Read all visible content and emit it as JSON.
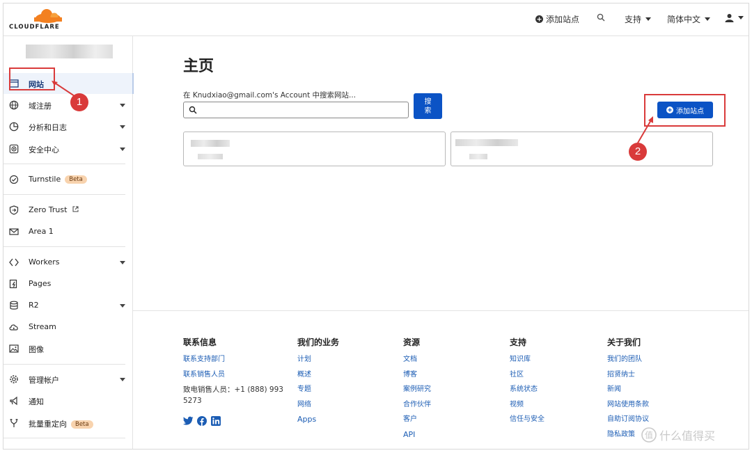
{
  "topbar": {
    "logo_text": "CLOUDFLARE",
    "add_site": "添加站点",
    "support": "支持",
    "language": "简体中文"
  },
  "sidebar": {
    "items": [
      {
        "label": "网站"
      },
      {
        "label": "域注册"
      },
      {
        "label": "分析和日志"
      },
      {
        "label": "安全中心"
      },
      {
        "label": "Turnstile",
        "badge": "Beta"
      },
      {
        "label": "Zero Trust"
      },
      {
        "label": "Area 1"
      },
      {
        "label": "Workers"
      },
      {
        "label": "Pages"
      },
      {
        "label": "R2"
      },
      {
        "label": "Stream"
      },
      {
        "label": "图像"
      },
      {
        "label": "管理帐户"
      },
      {
        "label": "通知"
      },
      {
        "label": "批量重定向",
        "badge": "Beta"
      }
    ]
  },
  "main": {
    "title": "主页",
    "search_label": "在 Knudxiao@gmail.com's Account 中搜索网站...",
    "search_button": "搜索",
    "add_site_button": "添加站点"
  },
  "annotations": {
    "one": "1",
    "two": "2"
  },
  "footer": {
    "contact": {
      "heading": "联系信息",
      "links": [
        "联系支持部门",
        "联系销售人员"
      ],
      "phone_text": "致电销售人员：+1 (888) 993 5273"
    },
    "business": {
      "heading": "我们的业务",
      "links": [
        "计划",
        "概述",
        "专题",
        "网络",
        "Apps"
      ]
    },
    "resources": {
      "heading": "资源",
      "links": [
        "文档",
        "博客",
        "案例研究",
        "合作伙伴",
        "客户",
        "API"
      ]
    },
    "support": {
      "heading": "支持",
      "links": [
        "知识库",
        "社区",
        "系统状态",
        "视频",
        "信任与安全"
      ]
    },
    "about": {
      "heading": "关于我们",
      "links": [
        "我们的团队",
        "招贤纳士",
        "新闻",
        "网站使用条款",
        "自助订阅协议",
        "隐私政策"
      ]
    }
  },
  "watermark": "什么值得买",
  "colors": {
    "accent": "#0b53c5",
    "annotation": "#d93a3a",
    "link": "#1c5db4",
    "logo_orange": "#f38020"
  }
}
